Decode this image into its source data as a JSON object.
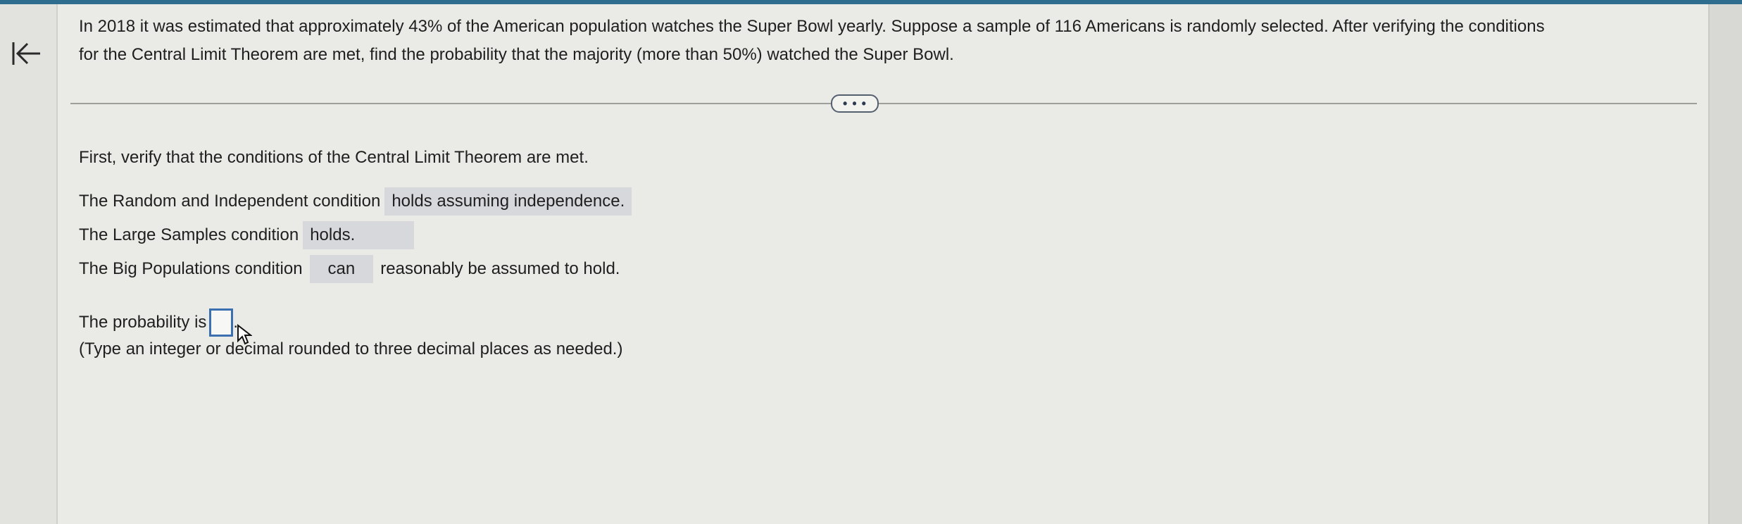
{
  "question": {
    "line1": "In 2018 it was estimated that approximately 43% of the American population watches the Super Bowl yearly. Suppose a sample of 116 Americans is randomly selected. After verifying the conditions",
    "line2": "for the Central Limit Theorem are met, find the probability that the majority (more than 50%) watched the Super Bowl."
  },
  "more_button": {
    "label": "• • •"
  },
  "verify_prompt": "First, verify that the conditions of the Central Limit Theorem are met.",
  "conditions": {
    "random": {
      "label": "The Random and Independent condition",
      "answer": "holds assuming independence."
    },
    "large": {
      "label": "The Large Samples condition",
      "answer": "holds."
    },
    "big": {
      "label": "The Big Populations condition",
      "answer": "can",
      "suffix": "reasonably be assumed to hold."
    }
  },
  "probability": {
    "label": "The probability is",
    "input_value": "",
    "period": ".",
    "instructions": "(Type an integer or decimal rounded to three decimal places as needed.)"
  },
  "colors": {
    "top_strip": "#2f6d8f",
    "answer_box_bg": "#d6d8dc",
    "input_border": "#3b6fb0"
  },
  "icons": {
    "back": "arrow-left-bar-icon",
    "cursor": "mouse-pointer-icon"
  }
}
